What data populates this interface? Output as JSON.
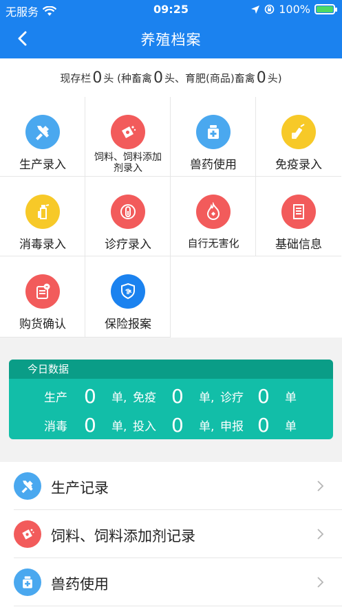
{
  "status_bar": {
    "carrier": "无服务",
    "time": "09:25",
    "battery": "100%"
  },
  "nav": {
    "title": "养殖档案"
  },
  "stock": {
    "prefix": "现存栏",
    "total": "0",
    "total_unit": "头 (种畜禽",
    "breeding": "0",
    "breeding_unit": "头、育肥(商品)畜禽",
    "fattening": "0",
    "fattening_unit": "头)"
  },
  "grid": [
    {
      "label": "生产录入",
      "icon": "hammer-icon",
      "color": "#4aa8ef"
    },
    {
      "label": "饲料、饲料添加剂录入",
      "icon": "feed-bag-icon",
      "color": "#f25b5b"
    },
    {
      "label": "兽药使用",
      "icon": "medicine-box-icon",
      "color": "#4aa8ef"
    },
    {
      "label": "免疫录入",
      "icon": "syringe-icon",
      "color": "#f7c928"
    },
    {
      "label": "消毒录入",
      "icon": "spray-bottle-icon",
      "color": "#f7c928"
    },
    {
      "label": "诊疗录入",
      "icon": "test-tube-icon",
      "color": "#f25b5b"
    },
    {
      "label": "自行无害化",
      "icon": "flame-icon",
      "color": "#f25b5b"
    },
    {
      "label": "基础信息",
      "icon": "document-icon",
      "color": "#f25b5b"
    },
    {
      "label": "购货确认",
      "icon": "purchase-icon",
      "color": "#f25b5b"
    },
    {
      "label": "保险报案",
      "icon": "insurance-shield-icon",
      "color": "#1b82ef"
    }
  ],
  "today": {
    "title": "今日数据",
    "rows": [
      [
        {
          "label": "生产",
          "value": "0",
          "unit": "单,"
        },
        {
          "label": "免疫",
          "value": "0",
          "unit": "单,"
        },
        {
          "label": "诊疗",
          "value": "0",
          "unit": "单"
        }
      ],
      [
        {
          "label": "消毒",
          "value": "0",
          "unit": "单,"
        },
        {
          "label": "投入",
          "value": "0",
          "unit": "单,"
        },
        {
          "label": "申报",
          "value": "0",
          "unit": "单"
        }
      ]
    ]
  },
  "records": [
    {
      "label": "生产记录",
      "icon": "hammer-icon",
      "color": "#4aa8ef"
    },
    {
      "label": "饲料、饲料添加剂记录",
      "icon": "feed-bag-icon",
      "color": "#f25b5b"
    },
    {
      "label": "兽药使用",
      "icon": "medicine-box-icon",
      "color": "#4aa8ef"
    }
  ]
}
